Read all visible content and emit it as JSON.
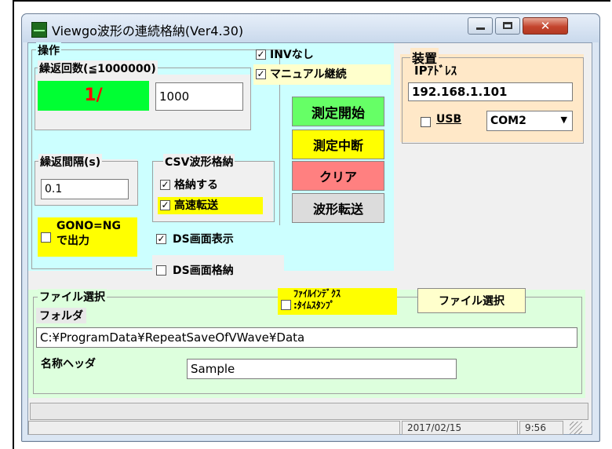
{
  "window": {
    "title": "Viewgo波形の連続格納(Ver4.30)"
  },
  "operation": {
    "legend": "操作",
    "repeat_count_legend": "繰返回数(≦1000000)",
    "counter_display": "1/",
    "repeat_count_value": "1000",
    "interval_legend": "繰返間隔(s)",
    "interval_value": "0.1",
    "gono_label": "GONO=NG\nで出力",
    "csv_legend": "CSV波形格納",
    "store_label": "格納する",
    "fast_transfer_label": "高速転送",
    "ds_display_label": "DS画面表示",
    "ds_store_label": "DS画面格納",
    "inv_label": "INVなし",
    "manual_continue_label": "マニュアル継続"
  },
  "buttons": {
    "start": "測定開始",
    "stop": "測定中断",
    "clear": "クリア",
    "transfer": "波形転送",
    "file_select": "ファイル選択"
  },
  "device": {
    "legend": "装置",
    "ip_label": "IPｱﾄﾞﾚｽ",
    "ip_value": "192.168.1.101",
    "usb_label": "USB",
    "com_value": "COM2"
  },
  "file": {
    "legend": "ファイル選択",
    "folder_label": "フォルダ",
    "folder_value": "C:¥ProgramData¥RepeatSaveOfVWave¥Data",
    "index_label": "ﾌｧｲﾙｲﾝﾃﾞｸｽ\n:ﾀｲﾑｽﾀﾝﾌﾟ",
    "header_label": "名称ヘッダ",
    "header_value": "Sample"
  },
  "status": {
    "date": "2017/02/15",
    "time": "9:56"
  },
  "checks": {
    "checked": "✓"
  },
  "colors": {
    "panel_cyan": "#ccffff",
    "device_peach": "#ffe8c8",
    "file_green": "#ddffdd",
    "yellow": "#ffff00",
    "green": "#66ff66",
    "counter_green": "#00ff33",
    "counter_red": "#ff0000",
    "red": "#ff8080",
    "manual_bg": "#ffffcc"
  }
}
